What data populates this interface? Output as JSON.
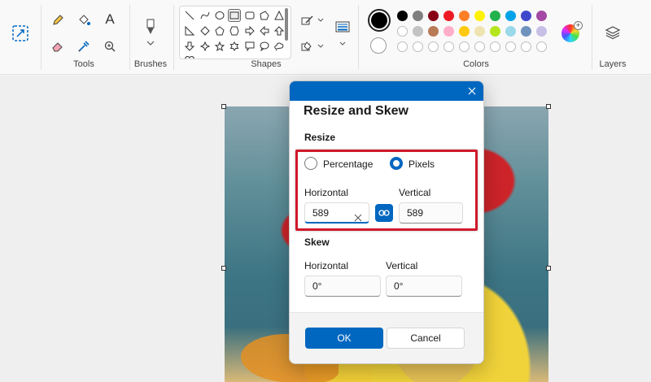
{
  "ribbon": {
    "groups": {
      "tools": "Tools",
      "brushes": "Brushes",
      "shapes": "Shapes",
      "colors": "Colors",
      "layers": "Layers"
    },
    "colors": {
      "row1": [
        "#000000",
        "#7f7f7f",
        "#880015",
        "#ed1c24",
        "#ff7f27",
        "#fff200",
        "#22b14c",
        "#00a2e8",
        "#3f48cc",
        "#a349a4"
      ],
      "row2": [
        "#ffffff",
        "#c3c3c3",
        "#b97a57",
        "#ffaec9",
        "#ffc90e",
        "#efe4b0",
        "#b5e61d",
        "#99d9ea",
        "#7092be",
        "#c8bfe7"
      ],
      "primary": "#000000",
      "secondary": "#ffffff"
    }
  },
  "dialog": {
    "title": "Resize and Skew",
    "resize": {
      "section_label": "Resize",
      "option_percentage": "Percentage",
      "option_pixels": "Pixels",
      "selected": "Pixels",
      "horizontal_label": "Horizontal",
      "vertical_label": "Vertical",
      "horizontal_value": "589",
      "vertical_value": "589",
      "aspect_locked": true
    },
    "skew": {
      "section_label": "Skew",
      "horizontal_label": "Horizontal",
      "vertical_label": "Vertical",
      "horizontal_value": "0°",
      "vertical_value": "0°"
    },
    "ok_label": "OK",
    "cancel_label": "Cancel"
  },
  "accent_color": "#0067c0",
  "highlight_color": "#d0192b"
}
